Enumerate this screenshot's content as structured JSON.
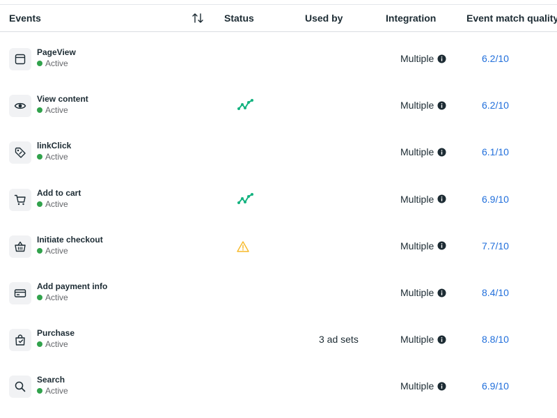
{
  "header": {
    "events": "Events",
    "status": "Status",
    "used_by": "Used by",
    "integration": "Integration",
    "event_match_quality": "Event match quality"
  },
  "colors": {
    "active_dot": "#31a24c",
    "trend_icon": "#15b380",
    "warning_icon": "#f7b928",
    "link": "#216fdb"
  },
  "rows": [
    {
      "name": "PageView",
      "status": "Active",
      "icon": "browser-window-icon",
      "status_icon": "",
      "used_by": "",
      "integration": "Multiple",
      "emq": "6.2/10"
    },
    {
      "name": "View content",
      "status": "Active",
      "icon": "eye-icon",
      "status_icon": "trend-icon",
      "used_by": "",
      "integration": "Multiple",
      "emq": "6.2/10"
    },
    {
      "name": "linkClick",
      "status": "Active",
      "icon": "tag-icon",
      "status_icon": "",
      "used_by": "",
      "integration": "Multiple",
      "emq": "6.1/10"
    },
    {
      "name": "Add to cart",
      "status": "Active",
      "icon": "cart-icon",
      "status_icon": "trend-icon",
      "used_by": "",
      "integration": "Multiple",
      "emq": "6.9/10"
    },
    {
      "name": "Initiate checkout",
      "status": "Active",
      "icon": "basket-icon",
      "status_icon": "warning-icon",
      "used_by": "",
      "integration": "Multiple",
      "emq": "7.7/10"
    },
    {
      "name": "Add payment info",
      "status": "Active",
      "icon": "credit-card-icon",
      "status_icon": "",
      "used_by": "",
      "integration": "Multiple",
      "emq": "8.4/10"
    },
    {
      "name": "Purchase",
      "status": "Active",
      "icon": "shopping-bag-icon",
      "status_icon": "",
      "used_by": "3 ad sets",
      "integration": "Multiple",
      "emq": "8.8/10"
    },
    {
      "name": "Search",
      "status": "Active",
      "icon": "search-icon",
      "status_icon": "",
      "used_by": "",
      "integration": "Multiple",
      "emq": "6.9/10"
    }
  ]
}
